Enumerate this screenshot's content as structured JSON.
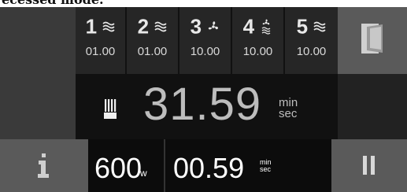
{
  "header_crop_text": "ecessed mode.",
  "steps": [
    {
      "number": "1",
      "icon": "microwave-waves-icon",
      "time": "01.00"
    },
    {
      "number": "2",
      "icon": "microwave-waves-icon",
      "time": "01.00"
    },
    {
      "number": "3",
      "icon": "fan-icon",
      "time": "10.00"
    },
    {
      "number": "4",
      "icon": "fan-waves-icon",
      "time": "10.00"
    },
    {
      "number": "5",
      "icon": "microwave-waves-icon",
      "time": "10.00"
    }
  ],
  "main_timer": {
    "value": "31.59",
    "unit_top": "min",
    "unit_bottom": "sec",
    "icon": "cooking-heat-icon"
  },
  "power": {
    "value": "600",
    "unit": "w"
  },
  "remaining": {
    "value": "00.59",
    "unit_top": "min",
    "unit_bottom": "sec"
  },
  "buttons": {
    "info_icon": "info-icon",
    "pause_icon": "pause-icon",
    "door_icon": "door-open-icon"
  }
}
